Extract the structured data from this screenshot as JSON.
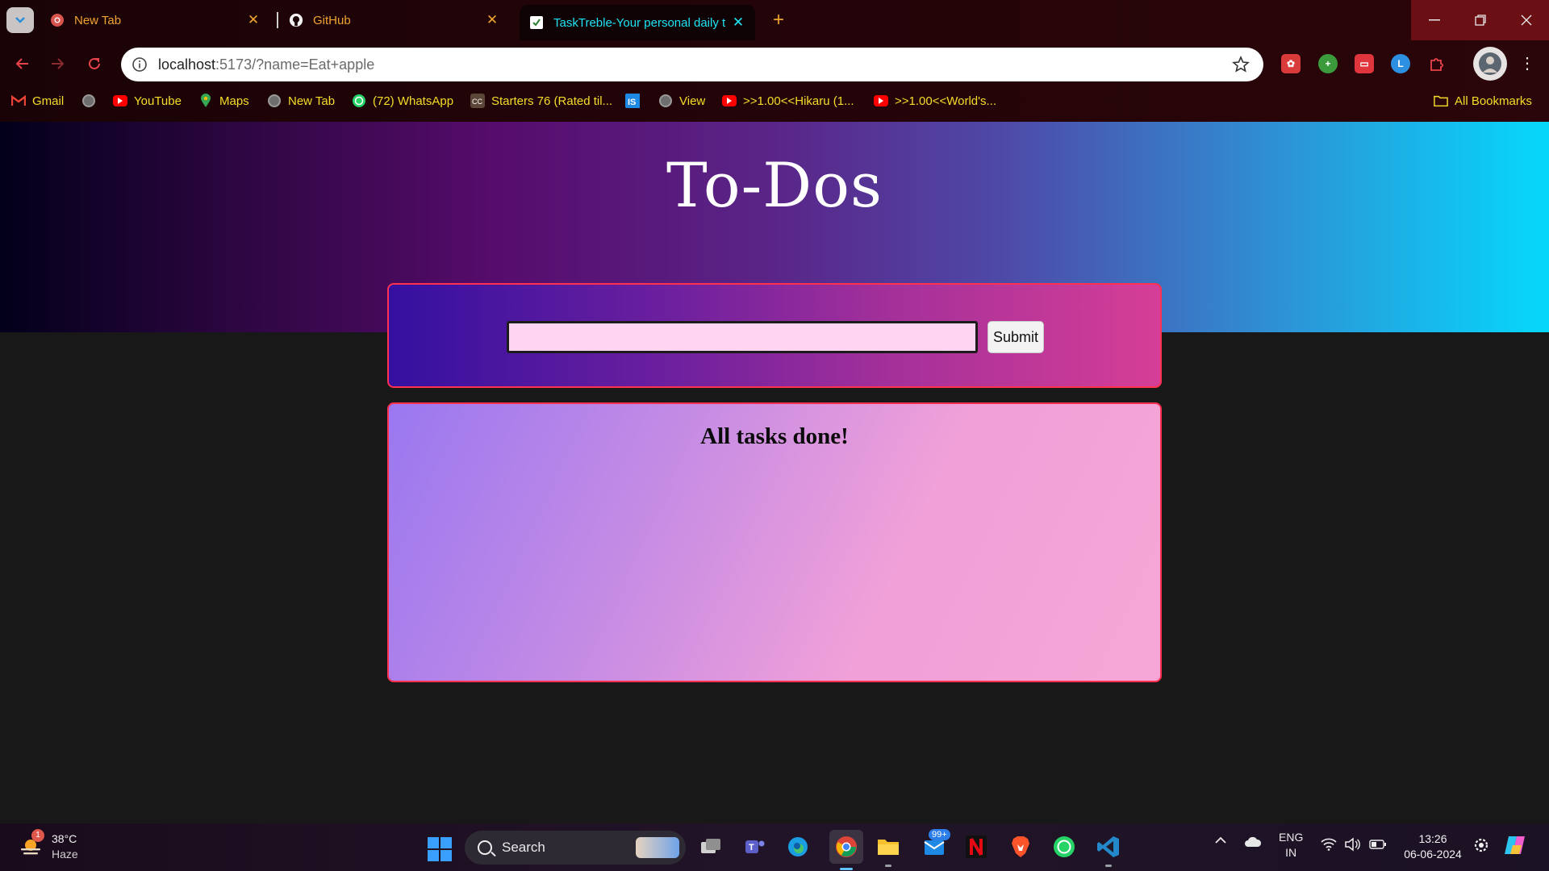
{
  "browser": {
    "tabs": [
      {
        "title": "New Tab",
        "icon": "chrome-icon"
      },
      {
        "title": "GitHub",
        "icon": "github-icon"
      },
      {
        "title": "TaskTreble-Your personal daily t",
        "icon": "checklist-icon",
        "active": true
      }
    ],
    "url_host": "localhost",
    "url_rest": ":5173/?name=Eat+apple",
    "bookmarks": [
      {
        "label": "Gmail",
        "icon": "gmail-icon"
      },
      {
        "label": "",
        "icon": "globe-icon"
      },
      {
        "label": "YouTube",
        "icon": "youtube-icon"
      },
      {
        "label": "Maps",
        "icon": "maps-icon"
      },
      {
        "label": "New Tab",
        "icon": "globe-icon"
      },
      {
        "label": "(72) WhatsApp",
        "icon": "whatsapp-icon"
      },
      {
        "label": "Starters 76 (Rated til...",
        "icon": "codechef-icon"
      },
      {
        "label": "",
        "icon": "is-icon"
      },
      {
        "label": "View",
        "icon": "globe-icon"
      },
      {
        "label": ">>1.00<<Hikaru (1...",
        "icon": "youtube-icon"
      },
      {
        "label": ">>1.00<<World's...",
        "icon": "youtube-icon"
      }
    ],
    "all_bookmarks": "All Bookmarks",
    "colors": {
      "bookmark_text": "#f5dd2a",
      "tab_text": "#f0a330",
      "active_tab_text": "#1fe4f5"
    }
  },
  "app": {
    "title": "To-Dos",
    "input_value": "",
    "submit_label": "Submit",
    "empty_message": "All tasks done!"
  },
  "taskbar": {
    "weather_badge": "1",
    "temperature": "38°C",
    "condition": "Haze",
    "search_label": "Search",
    "mail_badge": "99+",
    "language_line1": "ENG",
    "language_line2": "IN",
    "time": "13:26",
    "date": "06-06-2024"
  }
}
